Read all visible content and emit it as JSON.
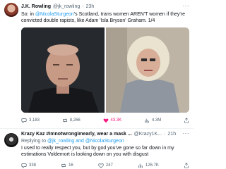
{
  "tweet1": {
    "name": "J.K. Rowling",
    "handle": "@jk_rowling",
    "dot": "·",
    "time": "23h",
    "more": "···",
    "text_a": "So: in ",
    "mention": "@NicolaSturgeon",
    "text_b": "'s Scotland, trans women AREN'T women if they're convicted double rapists, like Adam 'Isla Bryson' Graham. 1/4",
    "replies": "3,183",
    "retweets": "8,266",
    "likes": "43.3K",
    "views": "4.3M"
  },
  "tweet2": {
    "name": "Krazy Kaz #Imnotwrongimearly, wear a mask ...",
    "handle": "@Krazy1K...",
    "dot": "·",
    "time": "21h",
    "more": "···",
    "replying_prefix": "Replying to ",
    "replying_to": "@jk_rowling and @NicolaSturgeon",
    "text": "I used to really respect you, but by god you've gone so far down in my estimations Voldemort is looking down on you with disgust",
    "replies": "338",
    "retweets": "16",
    "likes": "247",
    "views": "126.7K"
  }
}
